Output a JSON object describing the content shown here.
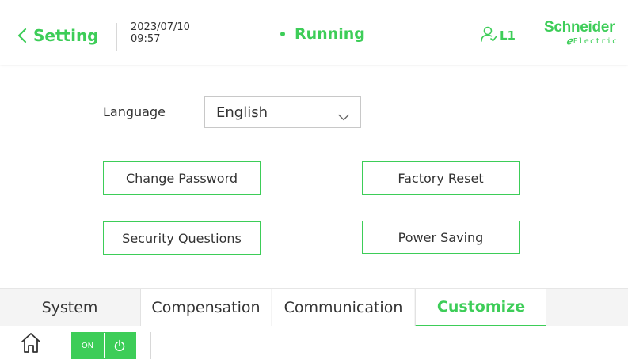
{
  "header": {
    "back_label": "Setting",
    "date": "2023/07/10",
    "time": "09:57",
    "status": "Running",
    "user_level": "L1",
    "logo_top": "Schneider",
    "logo_bottom": "Electric"
  },
  "settings": {
    "language_label": "Language",
    "language_value": "English",
    "change_password": "Change Password",
    "factory_reset": "Factory Reset",
    "security_questions": "Security Questions",
    "power_saving": "Power Saving"
  },
  "tabs": [
    {
      "label": "System"
    },
    {
      "label": "Compensation"
    },
    {
      "label": "Communication"
    },
    {
      "label": "Customize",
      "active": true
    }
  ],
  "bottombar": {
    "toggle_label": "ON"
  },
  "icons": {
    "back": "chevron-left-icon",
    "user": "user-icon",
    "dropdown": "chevron-down-icon",
    "home": "home-icon",
    "power": "power-icon"
  },
  "colors": {
    "accent": "#3dcd58",
    "text": "#333333",
    "tab_bg": "#f4f4f4",
    "border": "#c8c8c8"
  }
}
